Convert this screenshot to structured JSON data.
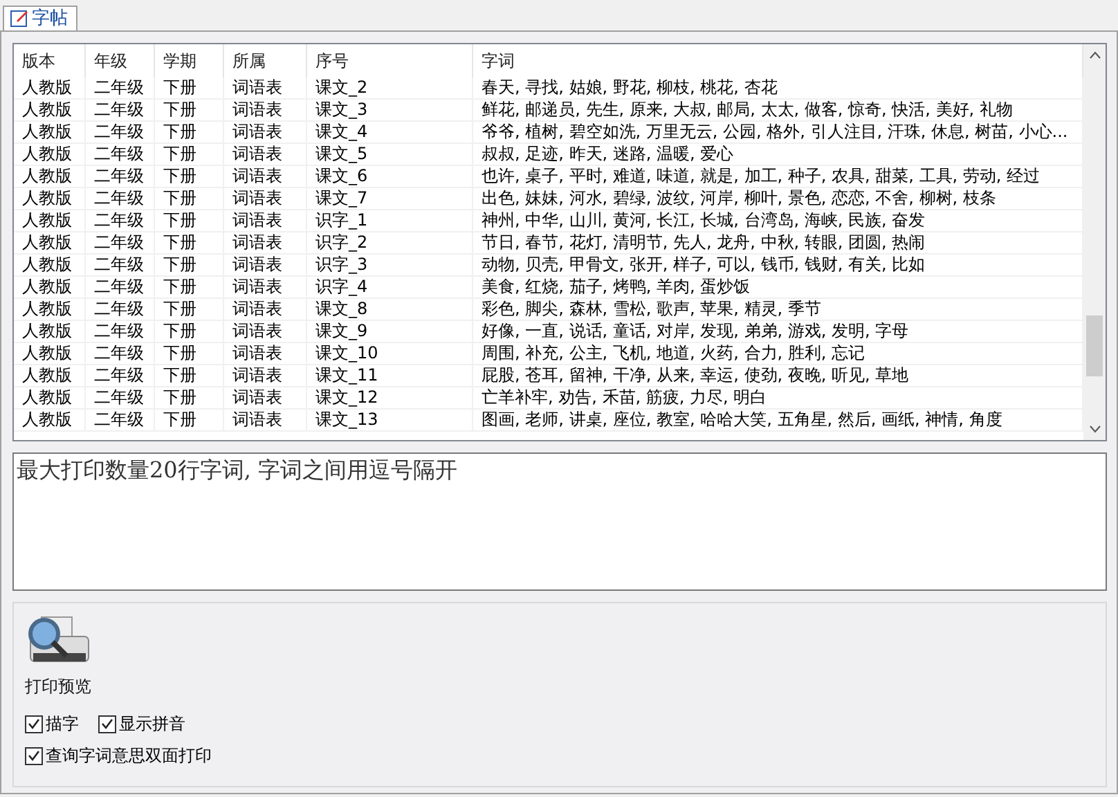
{
  "tabs": [
    {
      "label": "字帖",
      "selected": true
    }
  ],
  "table": {
    "columns": [
      "版本",
      "年级",
      "学期",
      "所属",
      "序号",
      "字词"
    ],
    "rows": [
      [
        "人教版",
        "二年级",
        "下册",
        "词语表",
        "课文_2",
        "春天, 寻找, 姑娘, 野花, 柳枝, 桃花, 杏花"
      ],
      [
        "人教版",
        "二年级",
        "下册",
        "词语表",
        "课文_3",
        "鲜花, 邮递员, 先生, 原来, 大叔, 邮局, 太太, 做客, 惊奇, 快活, 美好, 礼物"
      ],
      [
        "人教版",
        "二年级",
        "下册",
        "词语表",
        "课文_4",
        "爷爷, 植树, 碧空如洗, 万里无云, 公园, 格外, 引人注目, 汗珠, 休息, 树苗, 小心..."
      ],
      [
        "人教版",
        "二年级",
        "下册",
        "词语表",
        "课文_5",
        "叔叔, 足迹, 昨天, 迷路, 温暖, 爱心"
      ],
      [
        "人教版",
        "二年级",
        "下册",
        "词语表",
        "课文_6",
        "也许, 桌子, 平时, 难道, 味道, 就是, 加工, 种子, 农具, 甜菜, 工具, 劳动, 经过"
      ],
      [
        "人教版",
        "二年级",
        "下册",
        "词语表",
        "课文_7",
        "出色, 妹妹, 河水, 碧绿, 波纹, 河岸, 柳叶, 景色, 恋恋, 不舍, 柳树, 枝条"
      ],
      [
        "人教版",
        "二年级",
        "下册",
        "词语表",
        "识字_1",
        "神州, 中华, 山川, 黄河, 长江, 长城, 台湾岛, 海峡, 民族, 奋发"
      ],
      [
        "人教版",
        "二年级",
        "下册",
        "词语表",
        "识字_2",
        "节日, 春节, 花灯, 清明节, 先人, 龙舟, 中秋, 转眼, 团圆, 热闹"
      ],
      [
        "人教版",
        "二年级",
        "下册",
        "词语表",
        "识字_3",
        "动物, 贝壳, 甲骨文, 张开, 样子, 可以, 钱币, 钱财, 有关, 比如"
      ],
      [
        "人教版",
        "二年级",
        "下册",
        "词语表",
        "识字_4",
        "美食, 红烧, 茄子, 烤鸭, 羊肉, 蛋炒饭"
      ],
      [
        "人教版",
        "二年级",
        "下册",
        "词语表",
        "课文_8",
        "彩色, 脚尖, 森林, 雪松, 歌声, 苹果, 精灵, 季节"
      ],
      [
        "人教版",
        "二年级",
        "下册",
        "词语表",
        "课文_9",
        "好像, 一直, 说话, 童话, 对岸, 发现, 弟弟, 游戏, 发明, 字母"
      ],
      [
        "人教版",
        "二年级",
        "下册",
        "词语表",
        "课文_10",
        "周围, 补充, 公主, 飞机, 地道, 火药, 合力, 胜利, 忘记"
      ],
      [
        "人教版",
        "二年级",
        "下册",
        "词语表",
        "课文_11",
        "屁股, 苍耳, 留神, 干净, 从来, 幸运, 使劲, 夜晚, 听见, 草地"
      ],
      [
        "人教版",
        "二年级",
        "下册",
        "词语表",
        "课文_12",
        "亡羊补牢, 劝告, 禾苗, 筋疲, 力尽, 明白"
      ],
      [
        "人教版",
        "二年级",
        "下册",
        "词语表",
        "课文_13",
        "图画, 老师, 讲桌, 座位, 教室, 哈哈大笑, 五角星, 然后, 画纸, 神情, 角度"
      ]
    ]
  },
  "input": {
    "value": "最大打印数量20行字词, 字词之间用逗号隔开"
  },
  "print_preview": {
    "label": "打印预览"
  },
  "options": [
    {
      "label": "描字",
      "checked": true
    },
    {
      "label": "显示拼音",
      "checked": true
    },
    {
      "label": "查询字词意思双面打印",
      "checked": true
    }
  ]
}
